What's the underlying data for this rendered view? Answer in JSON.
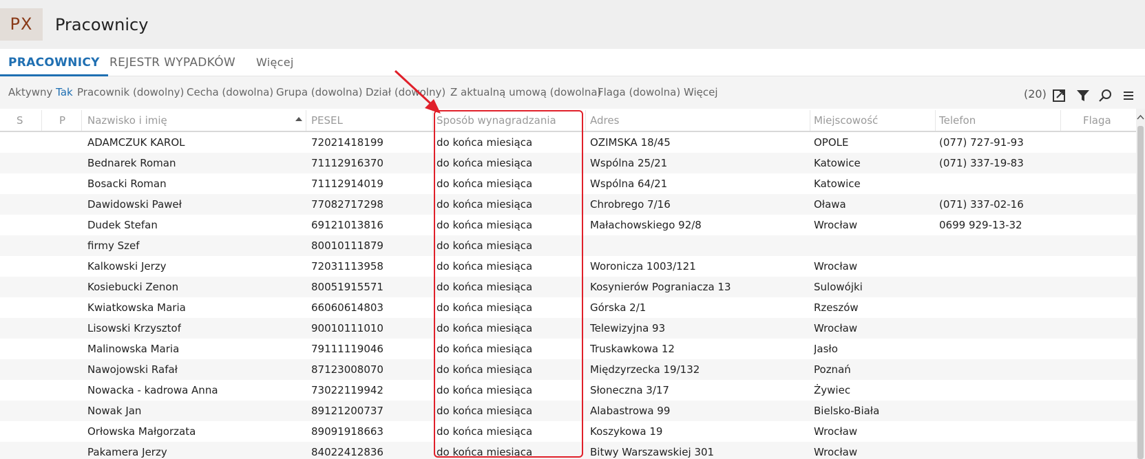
{
  "app": {
    "logo": "PX",
    "title": "Pracownicy"
  },
  "tabs": [
    {
      "label": "PRACOWNICY",
      "active": true
    },
    {
      "label": "REJESTR WYPADKÓW",
      "active": false
    },
    {
      "label": "Więcej",
      "active": false
    }
  ],
  "filters": {
    "active_label": "Aktywny",
    "active_value": "Tak",
    "employee": "Pracownik (dowolny)",
    "feature": "Cecha (dowolna)",
    "group": "Grupa (dowolna)",
    "department": "Dział (dowolny)",
    "contract": "Z aktualną umową (dowolna)",
    "flag": "Flaga (dowolna)",
    "more": "Więcej",
    "count": "(20)"
  },
  "toolbar_icons": [
    "export-icon",
    "filter-icon",
    "search-icon",
    "menu-icon"
  ],
  "columns": {
    "s": "S",
    "p": "P",
    "name": "Nazwisko i imię",
    "pesel": "PESEL",
    "pay": "Sposób wynagradzania",
    "address": "Adres",
    "city": "Miejscowość",
    "phone": "Telefon",
    "flag": "Flaga"
  },
  "sort": {
    "column": "name",
    "direction": "ascending"
  },
  "rows": [
    {
      "name": "ADAMCZUK KAROL",
      "pesel": "72021418199",
      "pay": "do końca miesiąca",
      "address": "OZIMSKA 18/45",
      "city": "OPOLE",
      "phone": "(077) 727-91-93"
    },
    {
      "name": "Bednarek Roman",
      "pesel": "71112916370",
      "pay": "do końca miesiąca",
      "address": "Wspólna 25/21",
      "city": "Katowice",
      "phone": "(071) 337-19-83"
    },
    {
      "name": "Bosacki Roman",
      "pesel": "71112914019",
      "pay": "do końca miesiąca",
      "address": "Wspólna 64/21",
      "city": "Katowice",
      "phone": ""
    },
    {
      "name": "Dawidowski Paweł",
      "pesel": "77082717298",
      "pay": "do końca miesiąca",
      "address": "Chrobrego 7/16",
      "city": "Oława",
      "phone": "(071) 337-02-16"
    },
    {
      "name": "Dudek Stefan",
      "pesel": "69121013816",
      "pay": "do końca miesiąca",
      "address": "Małachowskiego 92/8",
      "city": "Wrocław",
      "phone": "0699 929-13-32"
    },
    {
      "name": "firmy Szef",
      "pesel": "80010111879",
      "pay": "do końca miesiąca",
      "address": "",
      "city": "",
      "phone": ""
    },
    {
      "name": "Kalkowski Jerzy",
      "pesel": "72031113958",
      "pay": "do końca miesiąca",
      "address": "Woronicza 1003/121",
      "city": "Wrocław",
      "phone": ""
    },
    {
      "name": "Kosiebucki Zenon",
      "pesel": "80051915571",
      "pay": "do końca miesiąca",
      "address": "Kosynierów Pograniacza 13",
      "city": "Sulowójki",
      "phone": ""
    },
    {
      "name": "Kwiatkowska Maria",
      "pesel": "66060614803",
      "pay": "do końca miesiąca",
      "address": "Górska 2/1",
      "city": "Rzeszów",
      "phone": ""
    },
    {
      "name": "Lisowski Krzysztof",
      "pesel": "90010111010",
      "pay": "do końca miesiąca",
      "address": "Telewizyjna 93",
      "city": "Wrocław",
      "phone": ""
    },
    {
      "name": "Malinowska Maria",
      "pesel": "79111119046",
      "pay": "do końca miesiąca",
      "address": "Truskawkowa 12",
      "city": "Jasło",
      "phone": ""
    },
    {
      "name": "Nawojowski Rafał",
      "pesel": "87123008070",
      "pay": "do końca miesiąca",
      "address": "Międzyrzecka 19/132",
      "city": "Poznań",
      "phone": ""
    },
    {
      "name": "Nowacka - kadrowa Anna",
      "pesel": "73022119942",
      "pay": "do końca miesiąca",
      "address": "Słoneczna 3/17",
      "city": "Żywiec",
      "phone": ""
    },
    {
      "name": "Nowak Jan",
      "pesel": "89121200737",
      "pay": "do końca miesiąca",
      "address": "Alabastrowa 99",
      "city": "Bielsko-Biała",
      "phone": ""
    },
    {
      "name": "Orłowska Małgorzata",
      "pesel": "89091918663",
      "pay": "do końca miesiąca",
      "address": "Koszykowa 19",
      "city": "Wrocław",
      "phone": ""
    },
    {
      "name": "Pakamera Jerzy",
      "pesel": "84022412836",
      "pay": "do końca miesiąca",
      "address": "Bitwy Warszawskiej 301",
      "city": "Wrocław",
      "phone": ""
    }
  ],
  "colors": {
    "accent": "#1f6fb2",
    "highlight": "#e0202a",
    "logo_bg": "#e3ddd8",
    "logo_text": "#8a3a18"
  }
}
